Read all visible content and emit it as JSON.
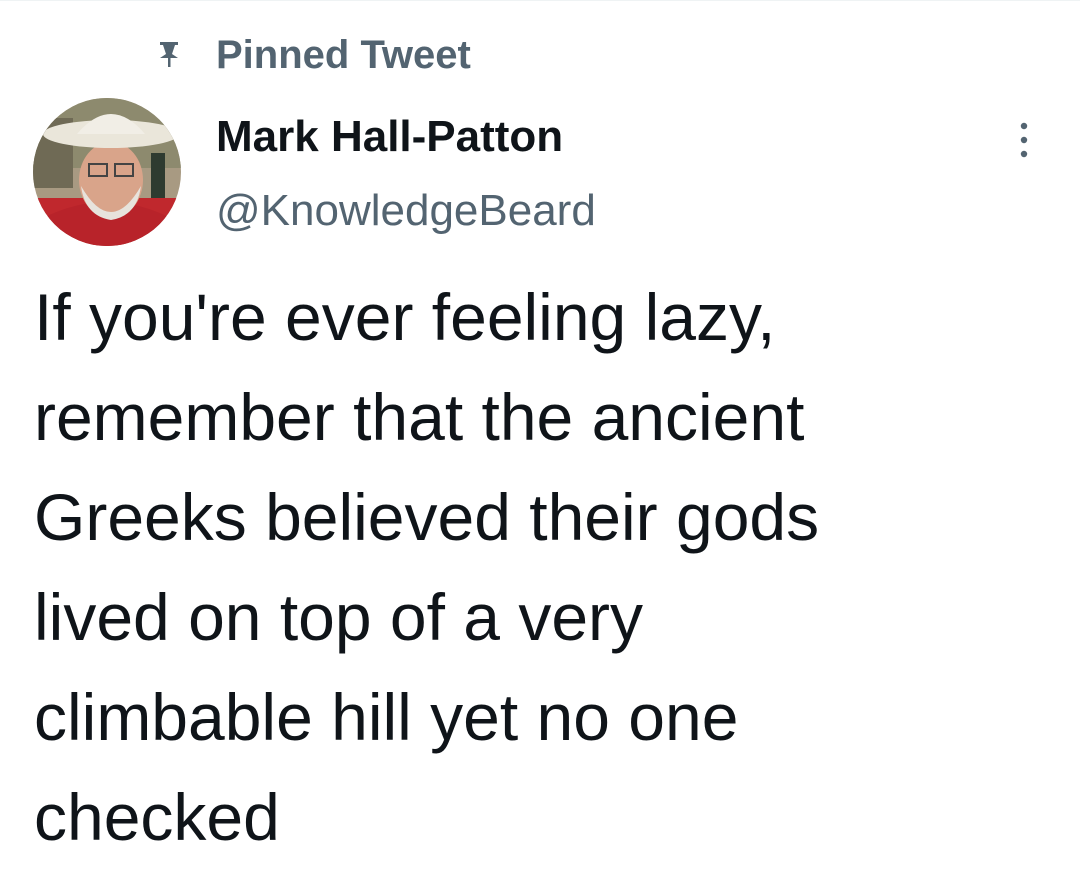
{
  "pinned": {
    "label": "Pinned Tweet",
    "icon": "pin-icon"
  },
  "author": {
    "display_name": "Mark Hall-Patton",
    "handle": "@KnowledgeBeard",
    "avatar_icon": "avatar"
  },
  "tweet": {
    "text": "If you're ever feeling lazy,\nremember that the ancient\nGreeks believed their gods\nlived on top of a very\nclimbable hill yet no one\nchecked"
  },
  "more_button": {
    "icon": "more-vertical-icon"
  },
  "colors": {
    "primary_text": "#0f1419",
    "secondary_text": "#536471",
    "background": "#ffffff"
  }
}
